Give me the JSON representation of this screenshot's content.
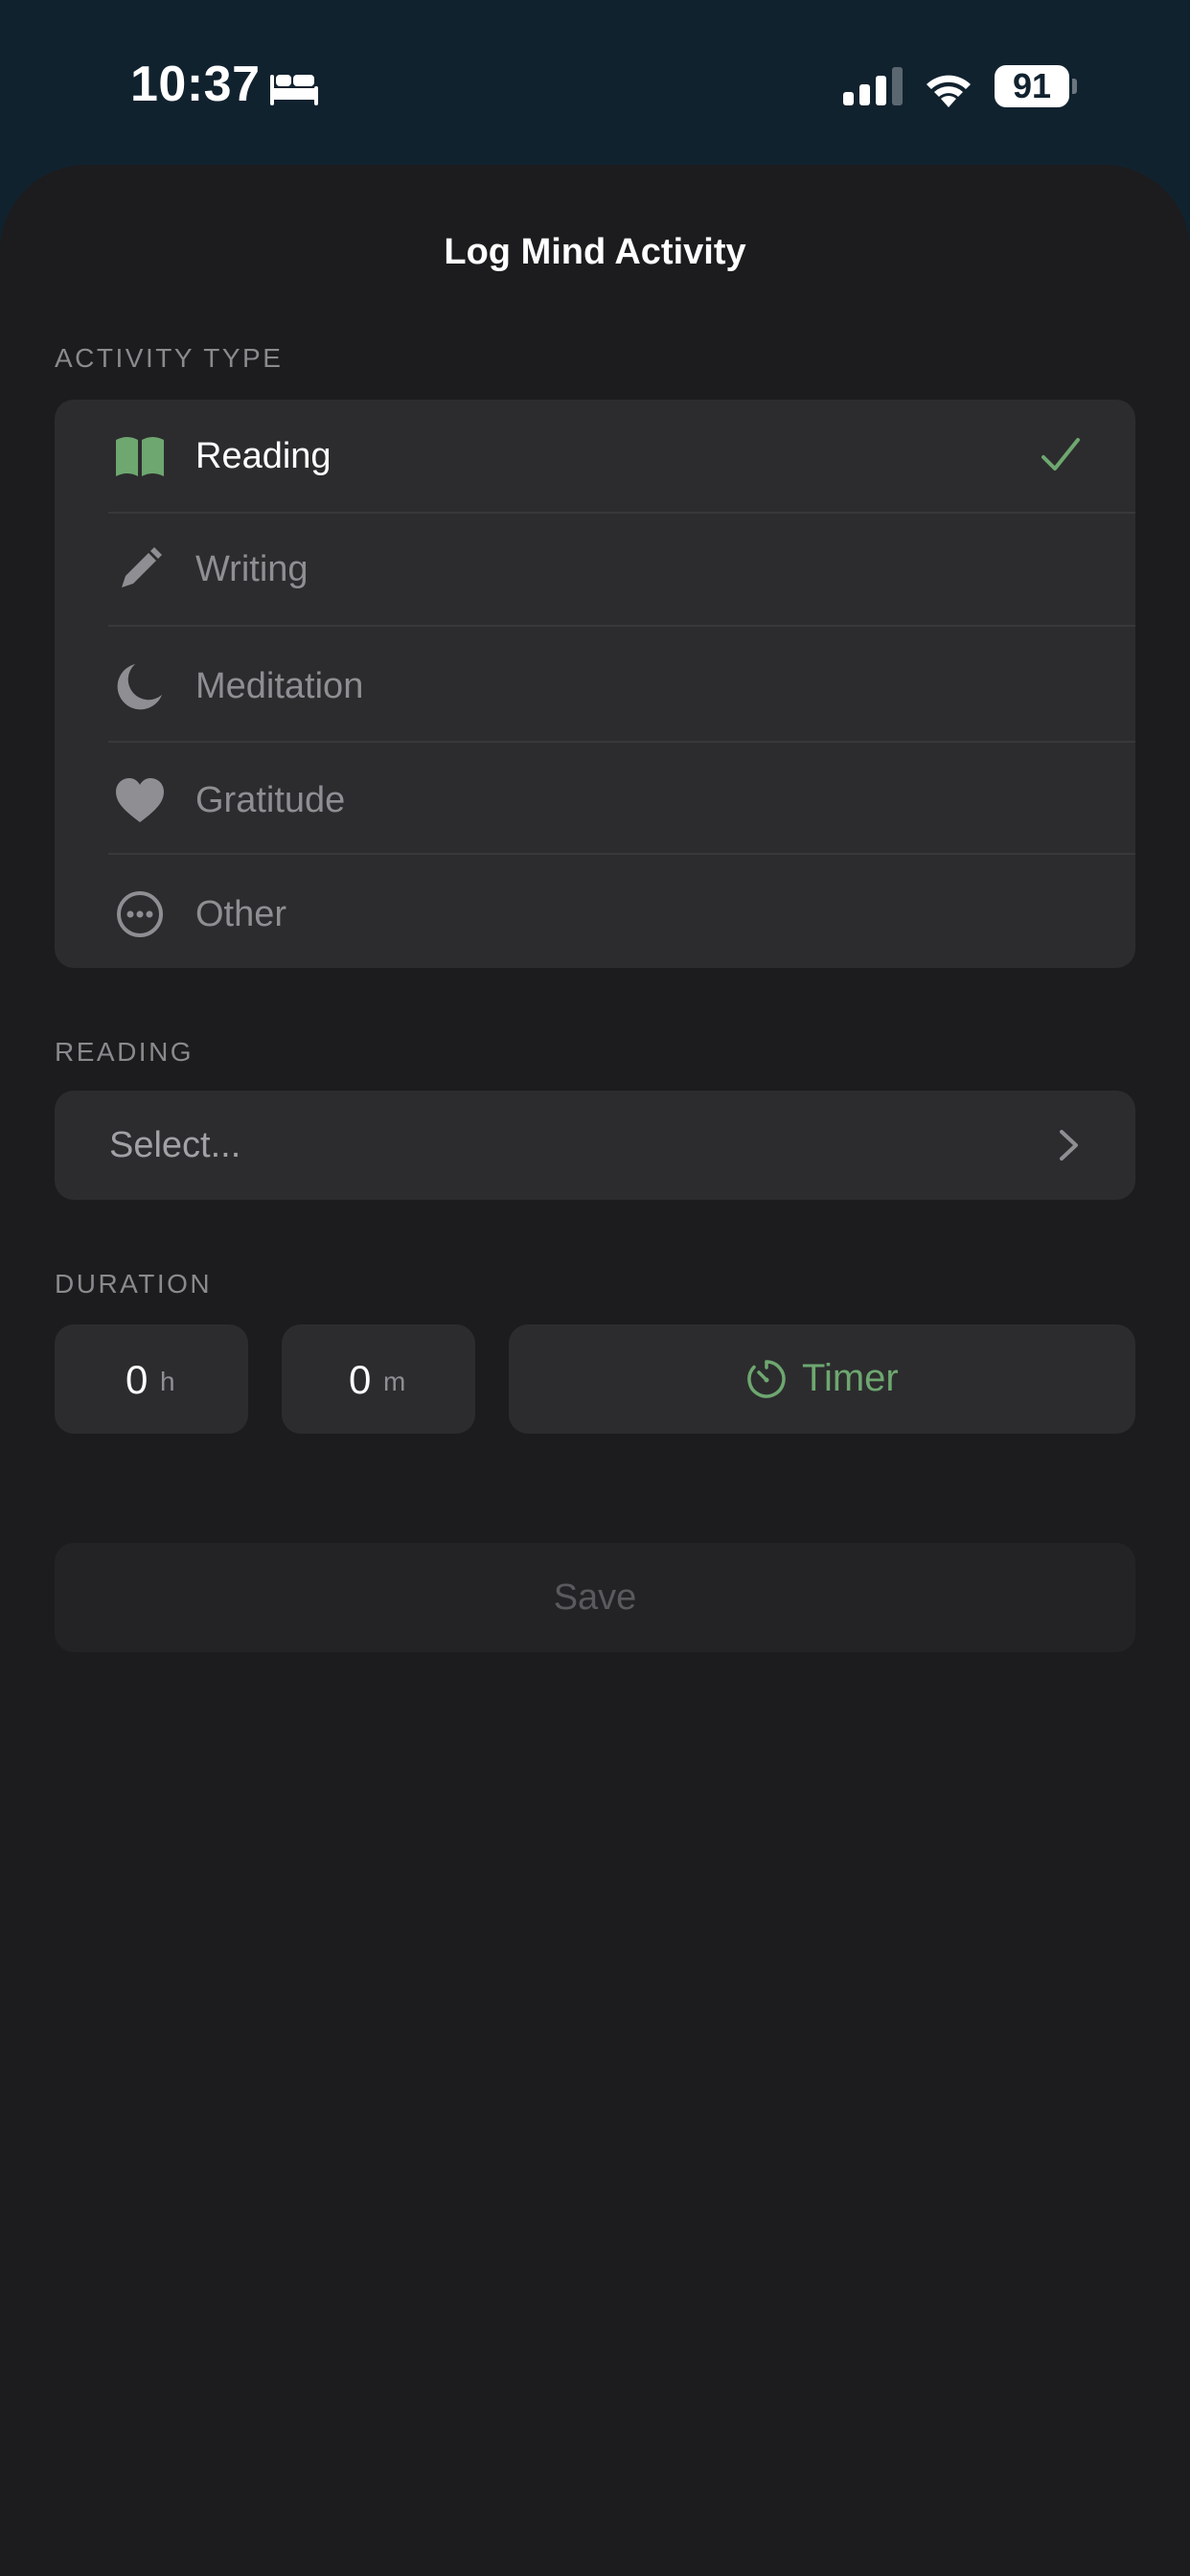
{
  "status_bar": {
    "time": "10:37",
    "battery": "91"
  },
  "sheet": {
    "title": "Log Mind Activity"
  },
  "activity_type": {
    "label": "ACTIVITY TYPE",
    "items": [
      {
        "label": "Reading",
        "icon": "book-icon",
        "selected": true
      },
      {
        "label": "Writing",
        "icon": "pencil-icon",
        "selected": false
      },
      {
        "label": "Meditation",
        "icon": "moon-icon",
        "selected": false
      },
      {
        "label": "Gratitude",
        "icon": "heart-icon",
        "selected": false
      },
      {
        "label": "Other",
        "icon": "ellipsis-circle-icon",
        "selected": false
      }
    ]
  },
  "reading": {
    "label": "READING",
    "select_placeholder": "Select..."
  },
  "duration": {
    "label": "DURATION",
    "hours_value": "0",
    "hours_unit": "h",
    "minutes_value": "0",
    "minutes_unit": "m",
    "timer_label": "Timer"
  },
  "save": {
    "label": "Save"
  },
  "colors": {
    "accent": "#6ea770",
    "background": "#1c1c1e",
    "card": "#2c2c2e",
    "status_bar_bg": "#11222f"
  }
}
